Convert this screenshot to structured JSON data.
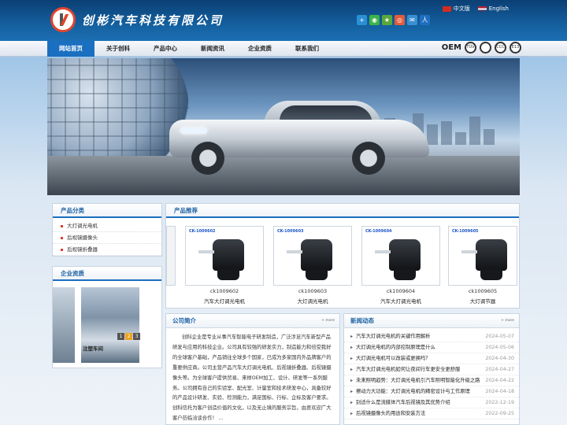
{
  "header": {
    "company_name": "创彬汽车科技有限公司",
    "lang_cn": "中文版",
    "lang_en": "English",
    "share_icons": [
      "qq-icon",
      "wechat-icon",
      "star-icon",
      "weibo-icon",
      "email-icon",
      "renren-icon"
    ]
  },
  "nav": {
    "items": [
      "网站首页",
      "关于创科",
      "产品中心",
      "新闻资讯",
      "企业资质",
      "联系我们"
    ],
    "active_index": 0,
    "certs": [
      "OEM",
      "TÜV",
      "",
      "CCC",
      "E13"
    ]
  },
  "sidebar": {
    "categories_title": "产品分类",
    "categories": [
      "大灯调光电机",
      "后视镜摄像头",
      "后视镜折叠器"
    ],
    "qualification_title": "企业资质",
    "qualification_caption": "注塑车间",
    "pager": [
      "1",
      "2",
      "3"
    ],
    "pager_active": 1
  },
  "products": {
    "title": "产品推荐",
    "items": [
      {
        "code": "CK-1009602",
        "id": "ck1009602",
        "name": "汽车大灯调光电机"
      },
      {
        "code": "CK-1009603",
        "id": "ck1009603",
        "name": "大灯调光电机"
      },
      {
        "code": "CK-1009604",
        "id": "ck1009604",
        "name": "汽车大灯调光电机"
      },
      {
        "code": "CK-1009605",
        "id": "ck1009605",
        "name": "大灯调节器"
      }
    ]
  },
  "intro": {
    "title": "公司简介",
    "more": "+ more",
    "text": "创科企业是专业从事汽车智能电子研发制造，广泛涉足汽车新型产品研发与应用的科技企业。公司具有较强的研发实力，制造能力和倍受我好的全球客户基础，产品销往全球多个国家，已成为多家国内外品牌客户的重要供应商。公司主营产品汽车大灯调光电机、后视镜折叠器、后视镜摄像头等。为全球客户提供贸易、来样OEM加工、设计、研发等一系列服务。公司拥有自己的实验室、配光室、计量室和技术研发中心，具备较好的产品设计研发、实验、检测能力，满足国标、行标、企标及客户要求。创科信托为客户创造价值的文化，以及无止境的服务宗旨，由衷欢迎广大客户莅临洽谈合作！ ..."
  },
  "news": {
    "title": "新闻动态",
    "more": "+ more",
    "items": [
      {
        "title": "汽车大灯调光电机的关键作用解析",
        "date": "2024-05-07"
      },
      {
        "title": "大灯调光电机的内部控制原理是什么",
        "date": "2024-05-06"
      },
      {
        "title": "大灯调光电机可以改装或更换吗？",
        "date": "2024-04-30"
      },
      {
        "title": "汽车大灯调光电机如何让夜间行车更安全更舒服",
        "date": "2024-04-27"
      },
      {
        "title": "未来照明趋势：大灯调光电机引汽车照明智能化升级之路",
        "date": "2024-04-22"
      },
      {
        "title": "擦动力大功能：大灯调光电机的精密设计与工作原理",
        "date": "2024-04-18"
      },
      {
        "title": "别适什么是流媒体汽车后视镜及其优势介绍",
        "date": "2022-12-19"
      },
      {
        "title": "后视镜摄像头的用途和安装方法",
        "date": "2022-09-25"
      }
    ]
  },
  "colors": {
    "brand_blue": "#1a6fc0",
    "header_dark": "#0b3f74",
    "logo_red": "#e0452e",
    "accent_title": "#1a5fa3"
  }
}
